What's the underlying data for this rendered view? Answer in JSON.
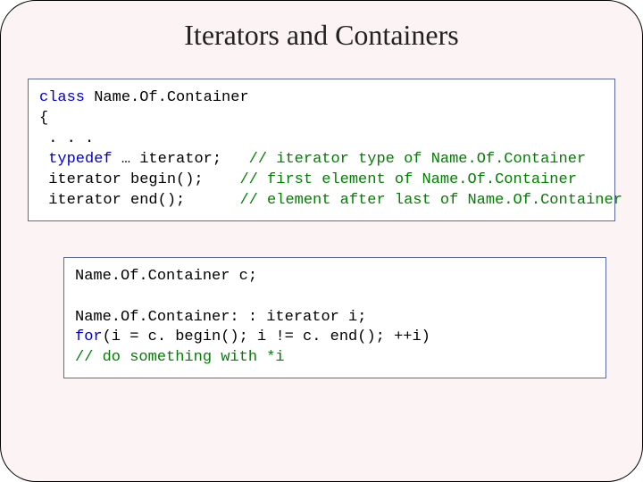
{
  "title": "Iterators and Containers",
  "box1": {
    "l1a": "class",
    "l1b": " Name.Of.Container",
    "l2": "{",
    "l3": " . . .",
    "l4a": " ",
    "l4b": "typedef",
    "l4c": " … iterator;   ",
    "l4d": "// iterator type of Name.Of.Container",
    "l5a": " iterator begin();    ",
    "l5b": "// first element of Name.Of.Container",
    "l6a": " iterator end();      ",
    "l6b": "// element after last of Name.Of.Container"
  },
  "box2": {
    "l1": "Name.Of.Container c;",
    "blank": " ",
    "l2": "Name.Of.Container: : iterator i;",
    "l3a": "for",
    "l3b": "(i = c. begin(); i != c. end(); ++i)",
    "l4": "// do something with *i"
  }
}
